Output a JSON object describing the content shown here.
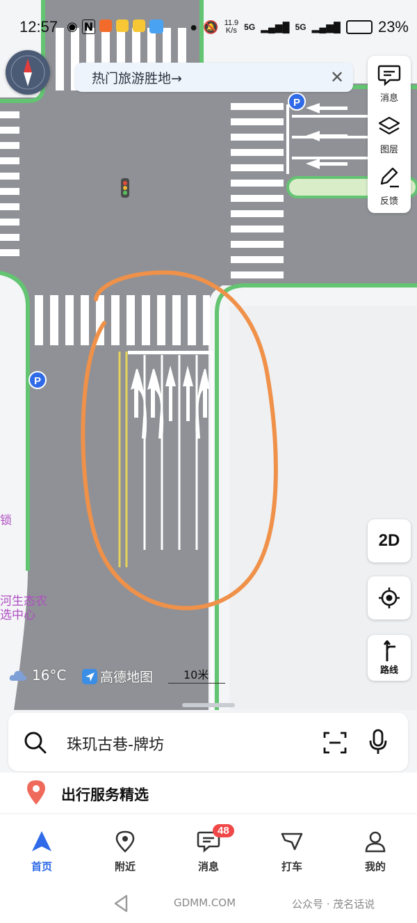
{
  "status_bar": {
    "time": "12:57",
    "net_speed_value": "11.9",
    "net_speed_unit": "K/s",
    "signal_1": "5G",
    "signal_2": "5G",
    "battery": "23%",
    "app_icons": [
      "eye-icon",
      "nfc-icon",
      "taobao-icon",
      "meituan-icon",
      "meituan-icon",
      "app-icon"
    ]
  },
  "banner": {
    "text": "热门旅游胜地→",
    "close_icon": "close-icon"
  },
  "right_panel": {
    "items": [
      {
        "label": "消息",
        "icon": "message-icon"
      },
      {
        "label": "图层",
        "icon": "layers-icon"
      },
      {
        "label": "反馈",
        "icon": "pencil-icon"
      }
    ]
  },
  "controls": {
    "view_mode": "2D",
    "locate_icon": "crosshair-icon",
    "route_label": "路线"
  },
  "map": {
    "poi_left_top": "锁",
    "poi_left_bottom_line1": "河生态农",
    "poi_left_bottom_line2": "选中心",
    "weather_temp": "16°C",
    "brand": "高德地图",
    "scale": "10米",
    "parking_label": "P",
    "colors": {
      "road": "#8f9196",
      "curb": "#63c472",
      "annotation": "#f0914a",
      "ground": "#f3f5f7"
    }
  },
  "search": {
    "value": "珠玑古巷-牌坊"
  },
  "service": {
    "title": "出行服务精选"
  },
  "tabs": [
    {
      "label": "首页",
      "icon": "arrow-nav-icon",
      "active": true
    },
    {
      "label": "附近",
      "icon": "pin-icon"
    },
    {
      "label": "消息",
      "icon": "message-icon",
      "badge": "48"
    },
    {
      "label": "打车",
      "icon": "taxi-icon"
    },
    {
      "label": "我的",
      "icon": "user-icon"
    }
  ],
  "watermark": {
    "left": "GDMM.COM",
    "right": "公众号 · 茂名话说"
  }
}
